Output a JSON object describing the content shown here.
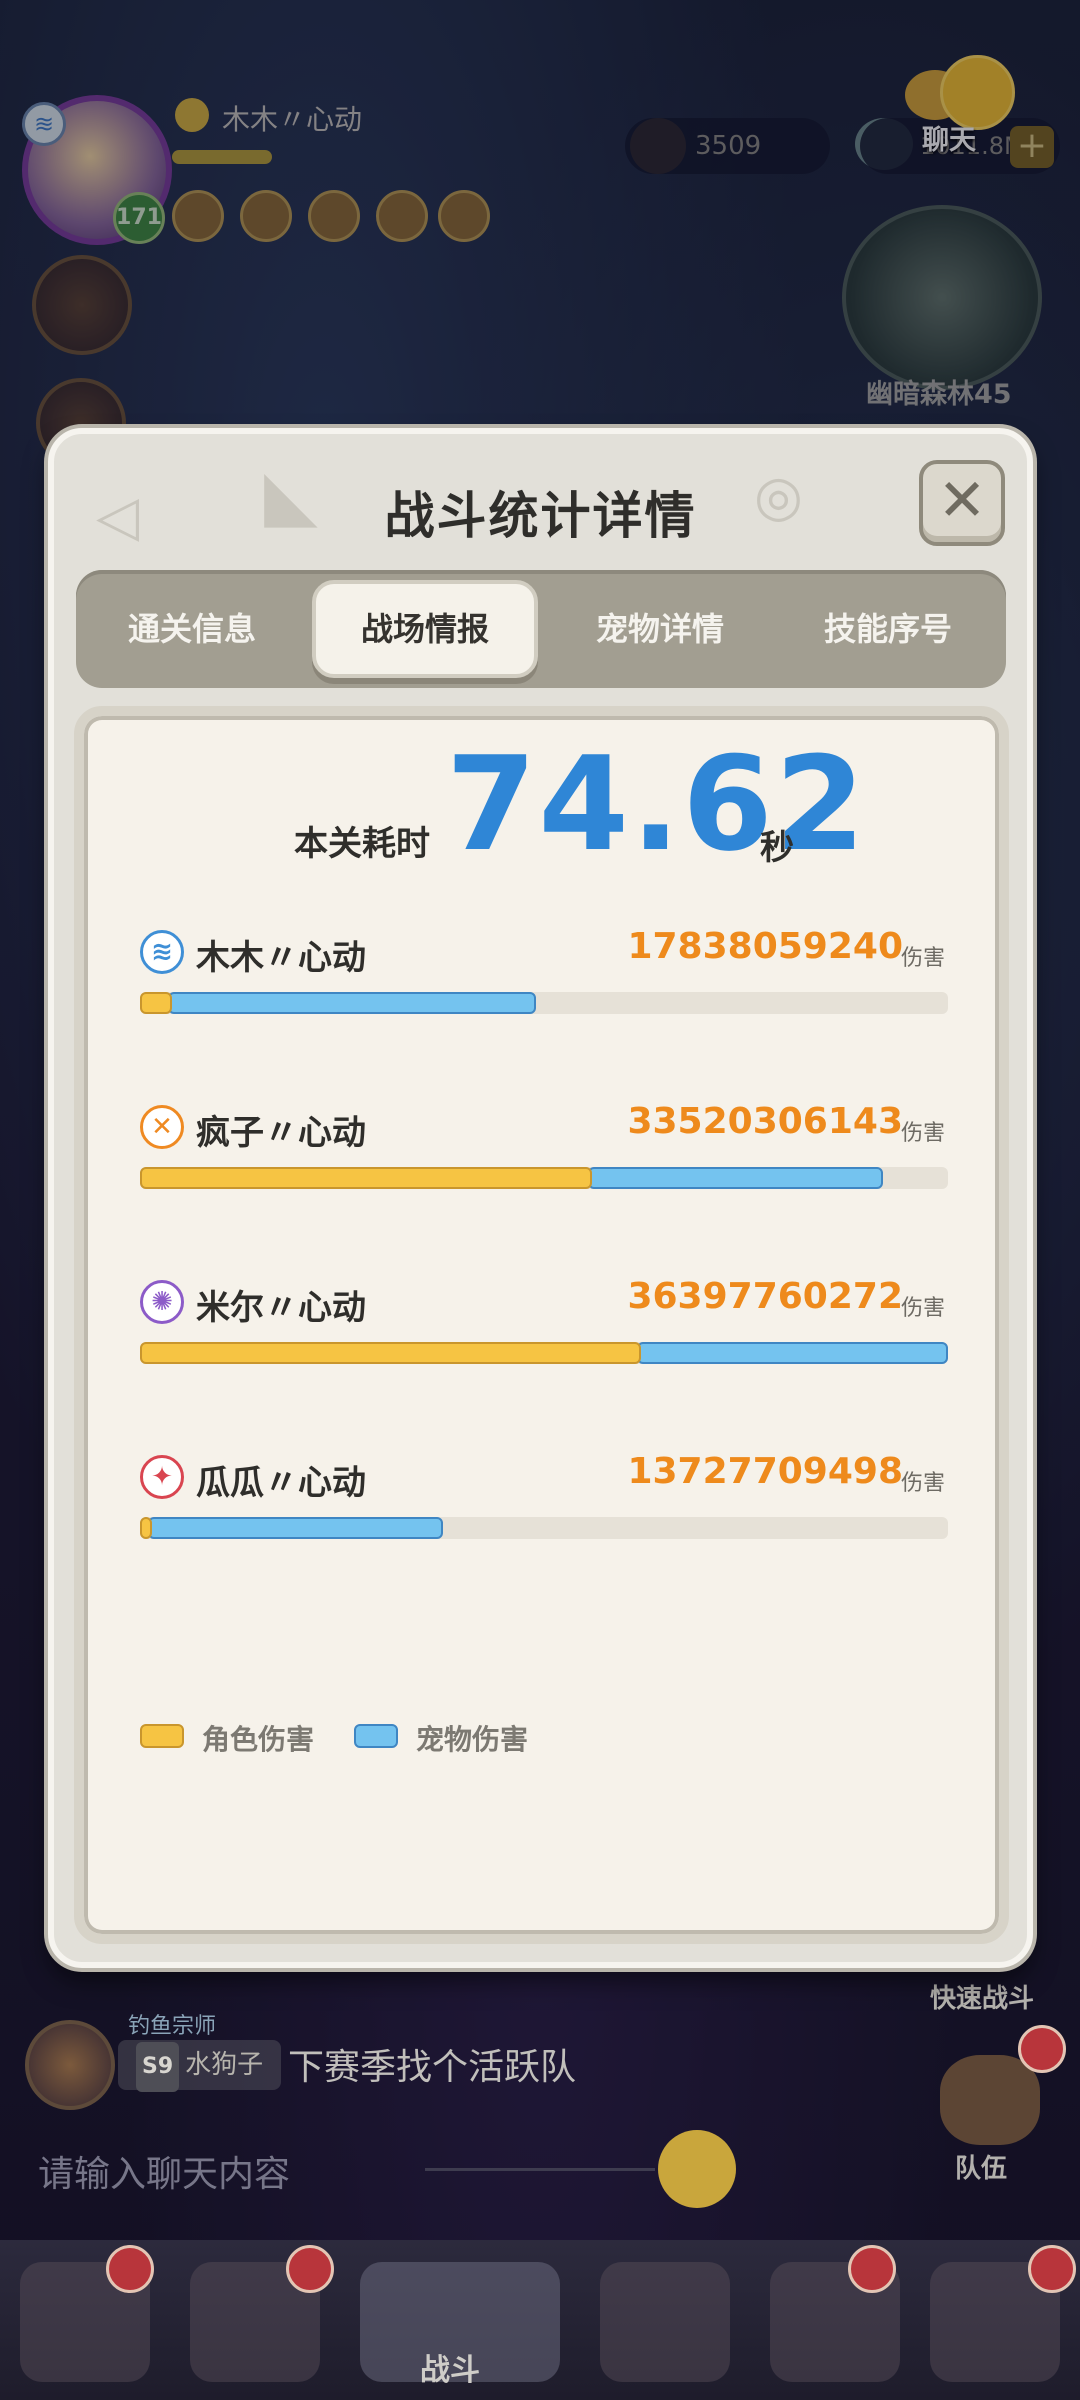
{
  "hud": {
    "player_name": "木木〃心动",
    "level": "171",
    "coins": "3509",
    "gems": "1011.8M",
    "chat_label": "聊天",
    "map_name": "幽暗森林45"
  },
  "modal": {
    "title": "战斗统计详情",
    "close_symbol": "✕",
    "tabs": [
      {
        "label": "通关信息",
        "active": false
      },
      {
        "label": "战场情报",
        "active": true
      },
      {
        "label": "宠物详情",
        "active": false
      },
      {
        "label": "技能序号",
        "active": false
      }
    ],
    "time_label": "本关耗时",
    "time_value": "74.62",
    "time_unit": "秒",
    "damage_unit": "伤害",
    "players": [
      {
        "name": "木木〃心动",
        "damage": "17838059240",
        "class_icon": "wind-class-icon",
        "icon_color": "#3f8fd6",
        "icon_glyph": "≋",
        "char_fraction": 0.04,
        "pet_fraction": 0.45
      },
      {
        "name": "疯子〃心动",
        "damage": "33520306143",
        "class_icon": "blade-class-icon",
        "icon_color": "#ef8a22",
        "icon_glyph": "✕",
        "char_fraction": 0.56,
        "pet_fraction": 0.36
      },
      {
        "name": "米尔〃心动",
        "damage": "36397760272",
        "class_icon": "magic-class-icon",
        "icon_color": "#8c5bc8",
        "icon_glyph": "✺",
        "char_fraction": 0.62,
        "pet_fraction": 0.38
      },
      {
        "name": "瓜瓜〃心动",
        "damage": "13727709498",
        "class_icon": "fighter-class-icon",
        "icon_color": "#d94550",
        "icon_glyph": "✦",
        "char_fraction": 0.015,
        "pet_fraction": 0.36
      }
    ],
    "legend": {
      "char_label": "角色伤害",
      "pet_label": "宠物伤害",
      "char_color": "#f6c443",
      "pet_color": "#74c3ef"
    }
  },
  "chat": {
    "sender_title": "钓鱼宗师",
    "sender_season": "S9",
    "sender_name": "水狗子",
    "message": "下赛季找个活跃队",
    "input_placeholder": "请输入聊天内容"
  },
  "side": {
    "quick_battle": "快速战斗",
    "team": "队伍"
  },
  "nav": {
    "battle": "战斗"
  }
}
